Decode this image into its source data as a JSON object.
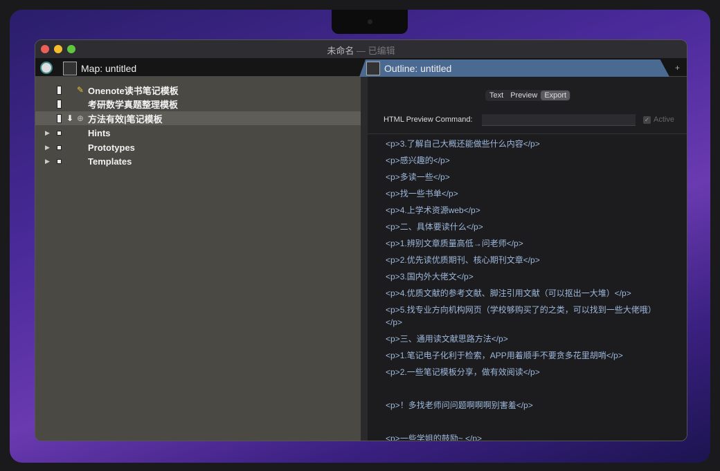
{
  "window": {
    "title": "未命名",
    "title_sep": " — ",
    "title_status": "已编辑"
  },
  "tabs": [
    {
      "label": "Map: untitled"
    },
    {
      "label": "Outline: untitled"
    }
  ],
  "add_tab": "+",
  "map": {
    "items": [
      {
        "label": "Onenote读书笔记模板",
        "icon": "note-icon",
        "badge": "pen-icon"
      },
      {
        "label": "考研数学真题整理模板",
        "icon": "note-icon"
      },
      {
        "label": "方法有效|笔记模板",
        "icon": "note-icon",
        "selected": true
      },
      {
        "label": "Hints",
        "icon": "container-icon",
        "expandable": true
      },
      {
        "label": "Prototypes",
        "icon": "container-icon",
        "expandable": true
      },
      {
        "label": "Templates",
        "icon": "container-icon",
        "expandable": true
      }
    ]
  },
  "outline": {
    "segments": [
      {
        "label": "Text"
      },
      {
        "label": "Preview"
      },
      {
        "label": "Export",
        "active": true
      }
    ],
    "html_preview_label": "HTML Preview Command:",
    "html_preview_value": "",
    "active_label": "Active",
    "active_checked": true,
    "lines": [
      "<p>3.了解自己大概还能做些什么内容</p>",
      "<p>感兴趣的</p>",
      "<p>多读一些</p>",
      "<p>找一些书单</p>",
      "<p>4.上学术资源web</p>",
      "<p>二、具体要读什么</p>",
      "<p>1.辨别文章质量高低→问老师</p>",
      "<p>2.优先读优质期刊、核心期刊文章</p>",
      "<p>3.国内外大佬文</p>",
      "<p>4.优质文献的参考文献、脚注引用文献（可以抠出一大堆）</p>",
      "<p>5.找专业方向机构网页（学校够购买了的之类，可以找到一些大佬哦）</p>",
      "<p>三、通用读文献思路方法</p>",
      "<p>1.笔记电子化利于检索，APP用着顺手不要贪多花里胡哨</p>",
      "<p>2.一些笔记模板分享，做有效阅读</p>",
      "",
      "<p>！多找老师问问题啊啊啊别害羞</p>",
      "",
      "<p>一些学姐的鼓励~ </p>"
    ]
  },
  "colors": {
    "tab_active": "#4a6a92",
    "text_code": "#9db8dc",
    "map_bg": "#4a4944"
  }
}
